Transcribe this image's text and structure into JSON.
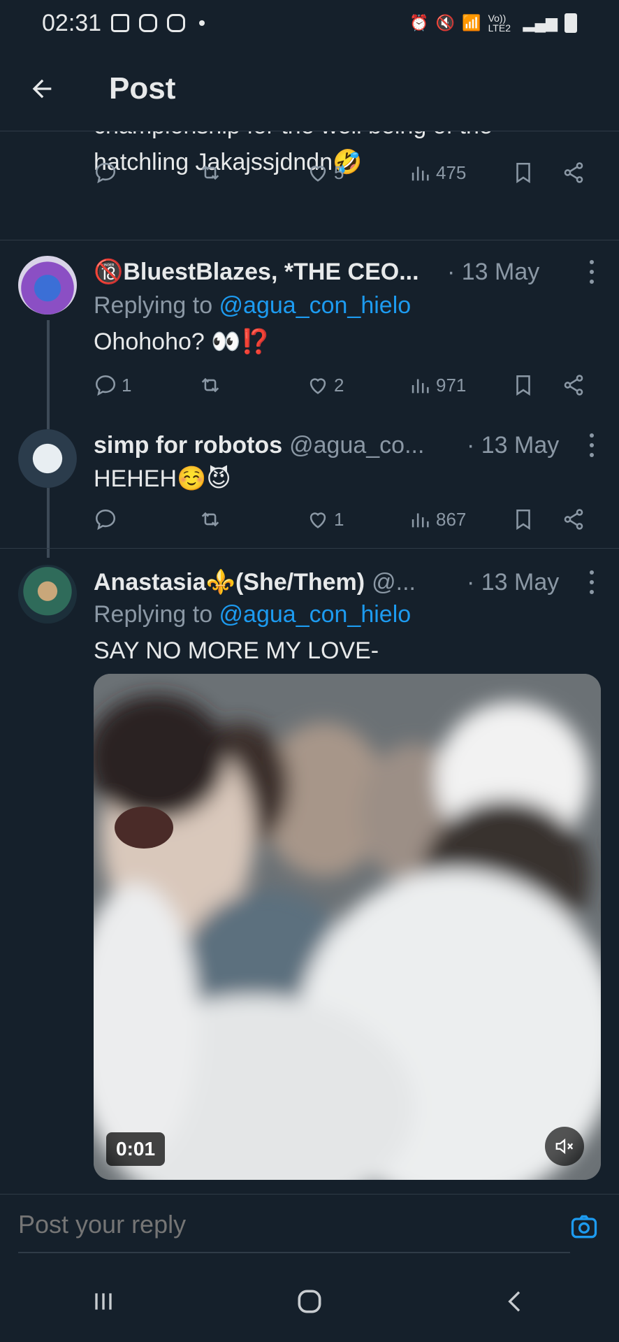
{
  "status_bar": {
    "time": "02:31",
    "network_label": "Vo)) LTE2"
  },
  "header": {
    "title": "Post"
  },
  "tweets": [
    {
      "partial_text_line1": "championship for the well being of the",
      "partial_text_line2": "hatchling Jakajssjdndn🤣",
      "replies": "",
      "retweets": "",
      "likes": "5",
      "views": "475"
    },
    {
      "name": "🔞BluestBlazes, *THE CEO...",
      "time": "· 13 May",
      "replying_prefix": "Replying to ",
      "replying_handle": "@agua_con_hielo",
      "text": "Ohohoho? 👀⁉️",
      "replies": "1",
      "retweets": "",
      "likes": "2",
      "views": "971"
    },
    {
      "name": "simp for robotos",
      "handle": "@agua_co...",
      "time": "· 13 May",
      "text": "HEHEH☺️😈",
      "replies": "",
      "retweets": "",
      "likes": "1",
      "views": "867"
    },
    {
      "name": "Anastasia⚜️(She/Them)",
      "handle": "@...",
      "time": "· 13 May",
      "replying_prefix": "Replying to ",
      "replying_handle": "@agua_con_hielo",
      "text": "SAY NO MORE MY LOVE-",
      "video_time": "0:01"
    }
  ],
  "reply_bar": {
    "placeholder": "Post your reply"
  },
  "colors": {
    "background": "#15202b",
    "link": "#1d9bf0",
    "muted": "#8b98a5"
  }
}
